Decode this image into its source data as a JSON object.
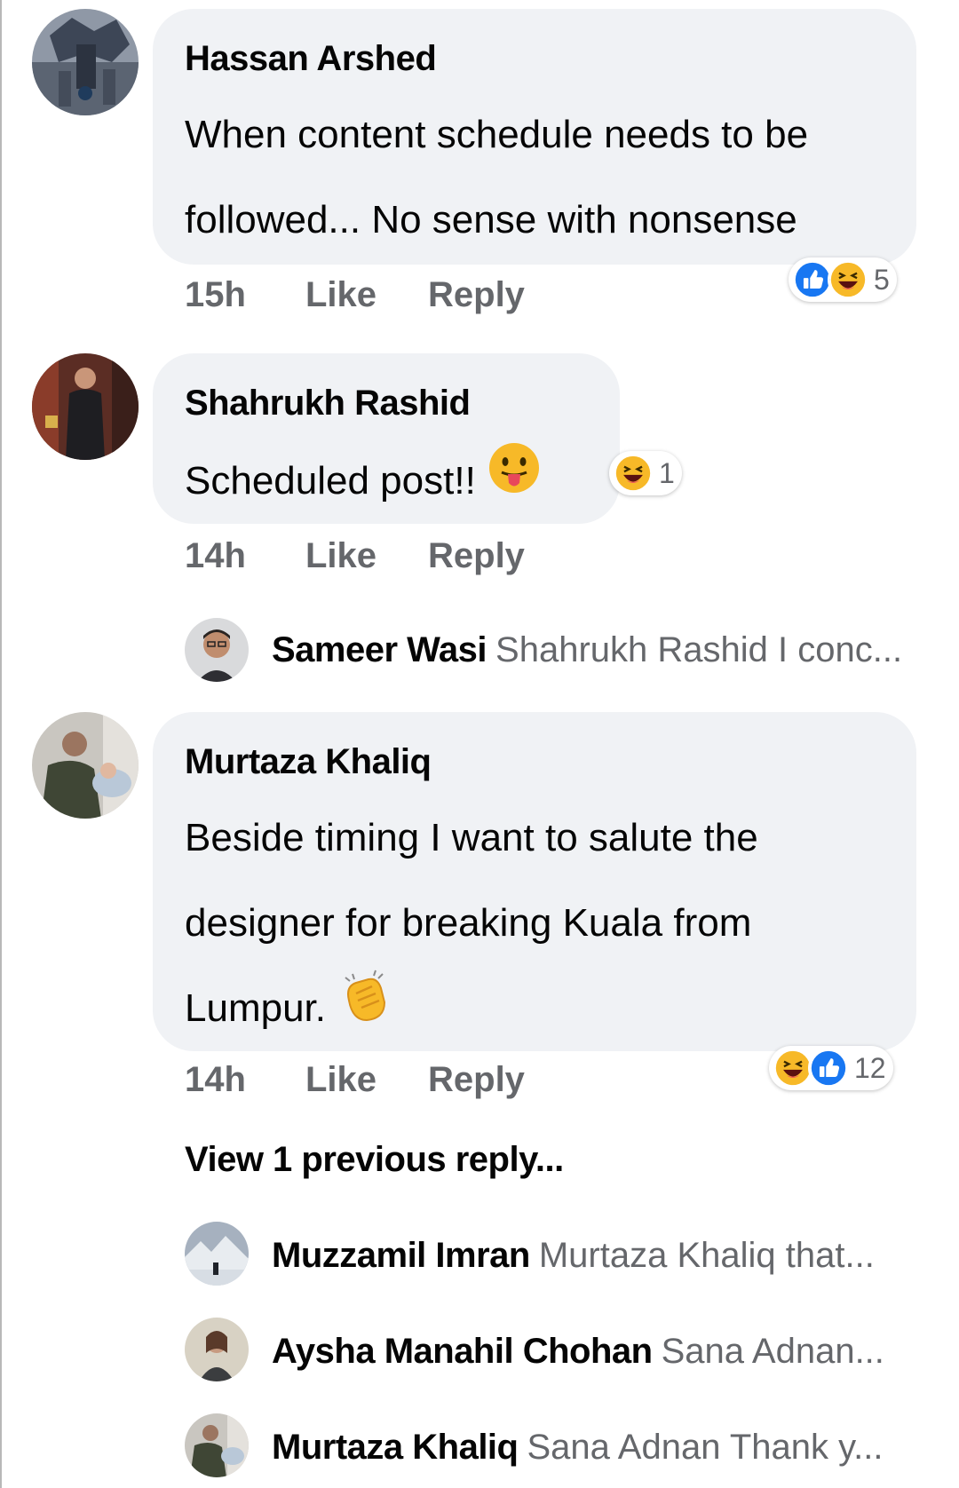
{
  "comments": [
    {
      "author": "Hassan Arshed",
      "text_line1": "When content schedule needs to be",
      "text_line2": "followed... No sense with nonsense",
      "time": "15h",
      "like_label": "Like",
      "reply_label": "Reply",
      "reactions": [
        "like",
        "haha"
      ],
      "reaction_count": "5"
    },
    {
      "author": "Shahrukh Rashid",
      "text_line1": "Scheduled post!!",
      "emoji": "tongue-face",
      "time": "14h",
      "like_label": "Like",
      "reply_label": "Reply",
      "reactions": [
        "haha"
      ],
      "reaction_count": "1",
      "replies": [
        {
          "name": "Sameer Wasi",
          "preview": "Shahrukh Rashid I conc..."
        }
      ]
    },
    {
      "author": "Murtaza Khaliq",
      "text_line1": "Beside timing I want to salute the",
      "text_line2": "designer for breaking Kuala from",
      "text_line3": "Lumpur.",
      "emoji": "clapping-hands",
      "time": "14h",
      "like_label": "Like",
      "reply_label": "Reply",
      "reactions": [
        "haha",
        "like"
      ],
      "reaction_count": "12",
      "view_previous": "View 1 previous reply...",
      "replies": [
        {
          "name": "Muzzamil Imran",
          "preview": "Murtaza Khaliq  that..."
        },
        {
          "name": "Aysha Manahil Chohan",
          "preview": "Sana Adnan..."
        },
        {
          "name": "Murtaza Khaliq",
          "preview": "Sana Adnan Thank y..."
        }
      ]
    }
  ],
  "colors": {
    "bubble": "#f0f2f5",
    "meta_text": "#65676b",
    "like_blue": "#1877f2",
    "haha_yellow": "#f7b928"
  }
}
